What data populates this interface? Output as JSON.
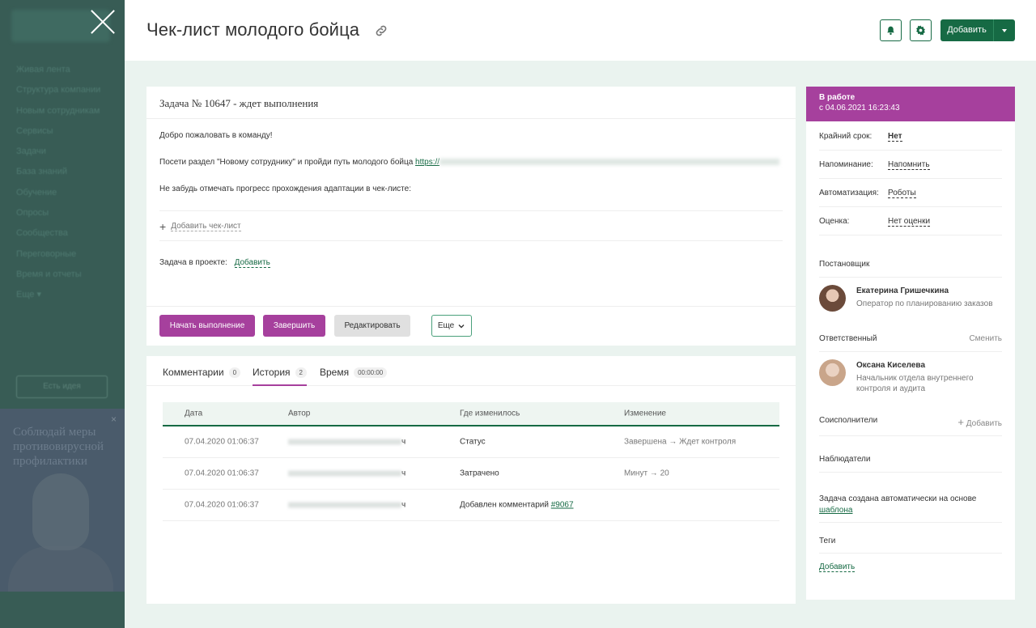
{
  "sidebar": {
    "menu": [
      "Живая лента",
      "Структура компании",
      "Новым сотрудникам",
      "Сервисы",
      "Задачи",
      "База знаний",
      "Обучение",
      "Опросы",
      "Сообщества",
      "Переговорные",
      "Время и отчеты",
      "Еще ▾"
    ],
    "idea_button": "Есть идея",
    "promo_text": "Соблюдай меры противовирусной профилактики",
    "promo_close": "×"
  },
  "header": {
    "title": "Чек-лист молодого бойца",
    "add_label": "Добавить"
  },
  "task": {
    "heading": "Задача № 10647 - ждет выполнения",
    "desc_1": "Добро пожаловать в команду!",
    "desc_2": "Посети раздел \"Новому сотруднику\" и пройди путь молодого бойца ",
    "desc_2_link": "https://",
    "desc_3": "Не забудь отмечать прогресс прохождения адаптации в чек-листе:",
    "add_checklist": "Добавить чек-лист",
    "project_label": "Задача в проекте:",
    "project_add": "Добавить",
    "buttons": {
      "start": "Начать выполнение",
      "finish": "Завершить",
      "edit": "Редактировать",
      "more": "Еще"
    }
  },
  "history": {
    "tabs": [
      {
        "label": "Комментарии",
        "badge": "0"
      },
      {
        "label": "История",
        "badge": "2"
      },
      {
        "label": "Время",
        "badge": "00:00:00"
      }
    ],
    "columns": [
      "Дата",
      "Автор",
      "Где изменилось",
      "Изменение"
    ],
    "rows": [
      {
        "date": "07.04.2020 01:06:37",
        "author_tail": "ч",
        "where": "Статус",
        "change": "Завершена → Ждет контроля",
        "link": ""
      },
      {
        "date": "07.04.2020 01:06:37",
        "author_tail": "ч",
        "where": "Затрачено",
        "change": "Минут → 20",
        "link": ""
      },
      {
        "date": "07.04.2020 01:06:37",
        "author_tail": "ч",
        "where": "Добавлен комментарий ",
        "change": "",
        "link": "#9067"
      }
    ]
  },
  "panel": {
    "status": "В работе",
    "status_since": "с 04.06.2021 16:23:43",
    "props": [
      {
        "key": "Крайний срок:",
        "value": "Нет"
      },
      {
        "key": "Напоминание:",
        "value": "Напомнить"
      },
      {
        "key": "Автоматизация:",
        "value": "Роботы"
      },
      {
        "key": "Оценка:",
        "value": "Нет оценки"
      }
    ],
    "creator_label": "Постановщик",
    "creator_name": "Екатерина Гришечкина",
    "creator_role": "Оператор по планированию заказов",
    "responsible_label": "Ответственный",
    "responsible_change": "Сменить",
    "responsible_name": "Оксана Киселева",
    "responsible_role": "Начальник отдела внутреннего контроля и аудита",
    "coexec_label": "Соисполнители",
    "coexec_add": "Добавить",
    "observers_label": "Наблюдатели",
    "auto_text": "Задача создана автоматически на основе",
    "auto_link": "шаблона",
    "tags_label": "Теги",
    "tags_add": "Добавить"
  },
  "colors": {
    "accent": "#166a44",
    "status": "#a6409d"
  }
}
